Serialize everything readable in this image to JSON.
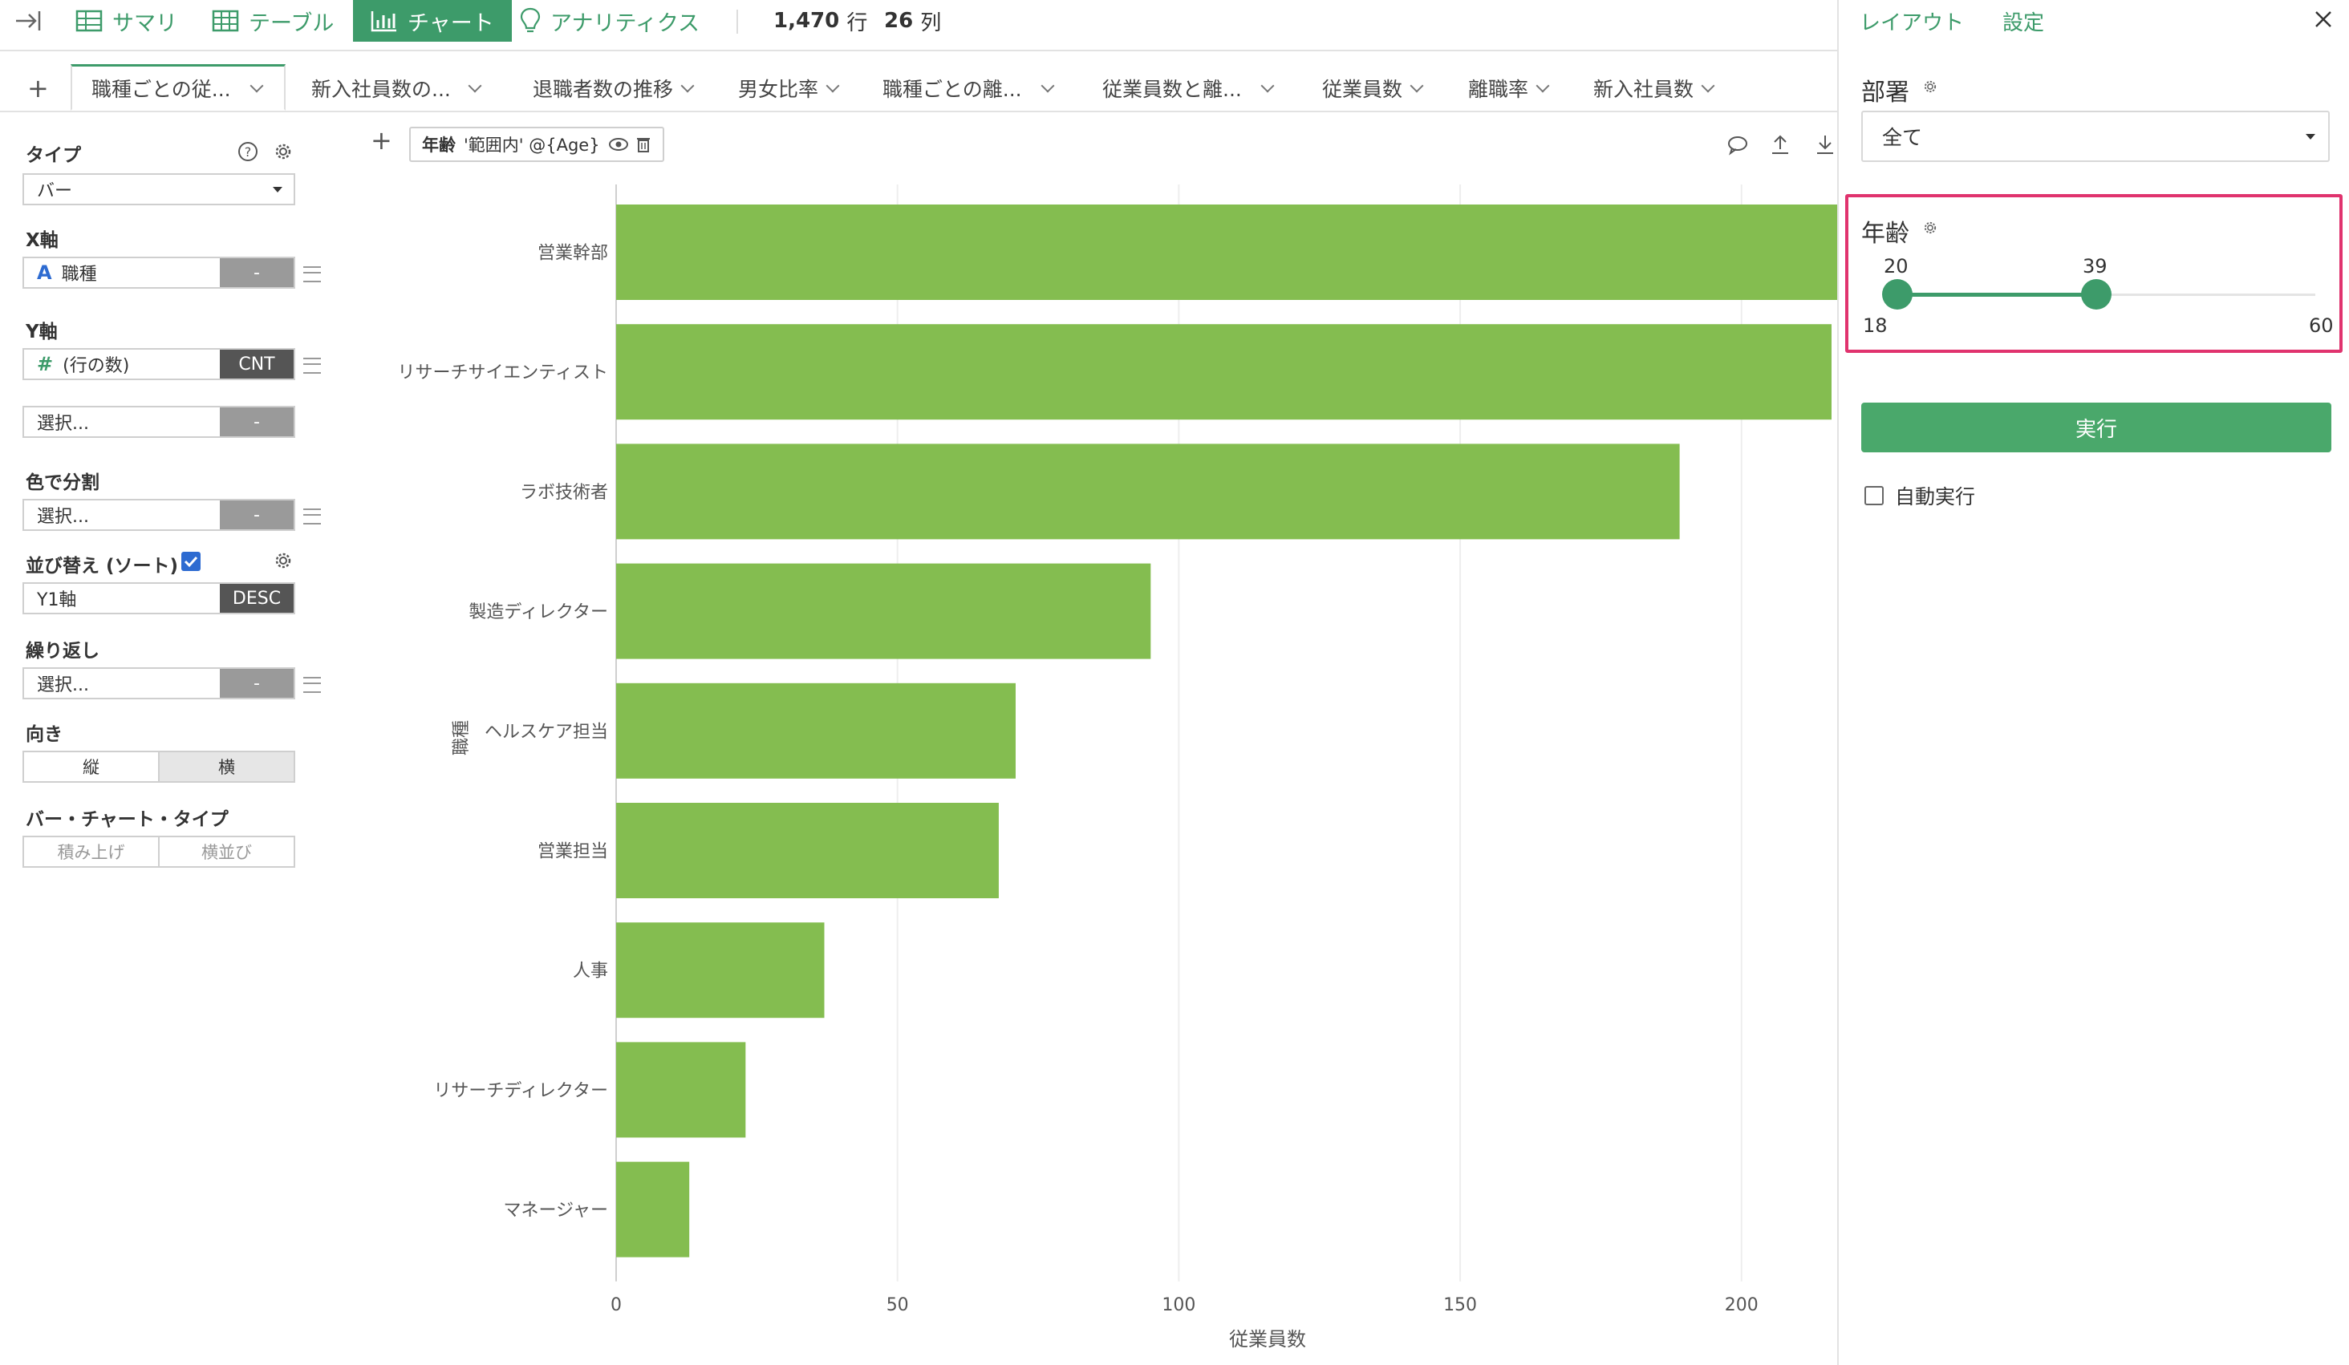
{
  "toolbar": {
    "collapse_icon": "collapse-right-icon",
    "summary": "サマリ",
    "table": "テーブル",
    "chart": "チャート",
    "analytics": "アナリティクス",
    "rows_num": "1,470",
    "rows_unit": "行",
    "cols_num": "26",
    "cols_unit": "列",
    "accent": "#3d9b6a"
  },
  "tabs": {
    "add": "+",
    "items": [
      "職種ごとの従...",
      "新入社員数の...",
      "退職者数の推移",
      "男女比率",
      "職種ごとの離...",
      "従業員数と離...",
      "従業員数",
      "離職率",
      "新入社員数"
    ]
  },
  "left_panel": {
    "type_label": "タイプ",
    "type_value": "バー",
    "x_label": "X軸",
    "x_value": "職種",
    "x_btn": "-",
    "y_label": "Y軸",
    "y_value": "(行の数)",
    "y_btn": "CNT",
    "y2_value": "選択...",
    "y2_btn": "-",
    "color_label": "色で分割",
    "color_value": "選択...",
    "color_btn": "-",
    "sort_label": "並び替え (ソート)",
    "sort_value": "Y1軸",
    "sort_btn": "DESC",
    "repeat_label": "繰り返し",
    "repeat_value": "選択...",
    "repeat_btn": "-",
    "orientation_label": "向き",
    "orientation_options": [
      "縦",
      "横"
    ],
    "orientation_selected": "横",
    "bar_type_label": "バー・チャート・タイプ",
    "bar_type_options": [
      "積み上げ",
      "横並び"
    ]
  },
  "filter_bar": {
    "add": "+",
    "chip_name": "年齢",
    "chip_detail": "'範囲内' @{Age}"
  },
  "chart_data": {
    "type": "bar",
    "orientation": "horizontal",
    "categories": [
      "営業幹部",
      "リサーチサイエンティスト",
      "ラボ技術者",
      "製造ディレクター",
      "ヘルスケア担当",
      "営業担当",
      "人事",
      "リサーチディレクター",
      "マネージャー"
    ],
    "values": [
      217,
      216,
      189,
      95,
      71,
      68,
      37,
      23,
      13
    ],
    "xlabel": "従業員数",
    "ylabel": "職種",
    "xlim": [
      0,
      217
    ],
    "xticks": [
      0,
      50,
      100,
      150,
      200
    ],
    "bar_color": "#84bd50",
    "grid": true
  },
  "right_panel": {
    "layout_link": "レイアウト",
    "settings_link": "設定",
    "dept_label": "部署",
    "dept_value": "全て",
    "age_label": "年齢",
    "age_low": "20",
    "age_high": "39",
    "age_min": "18",
    "age_max": "60",
    "run_label": "実行",
    "auto_run_label": "自動実行",
    "highlight_color": "#e0336e"
  }
}
